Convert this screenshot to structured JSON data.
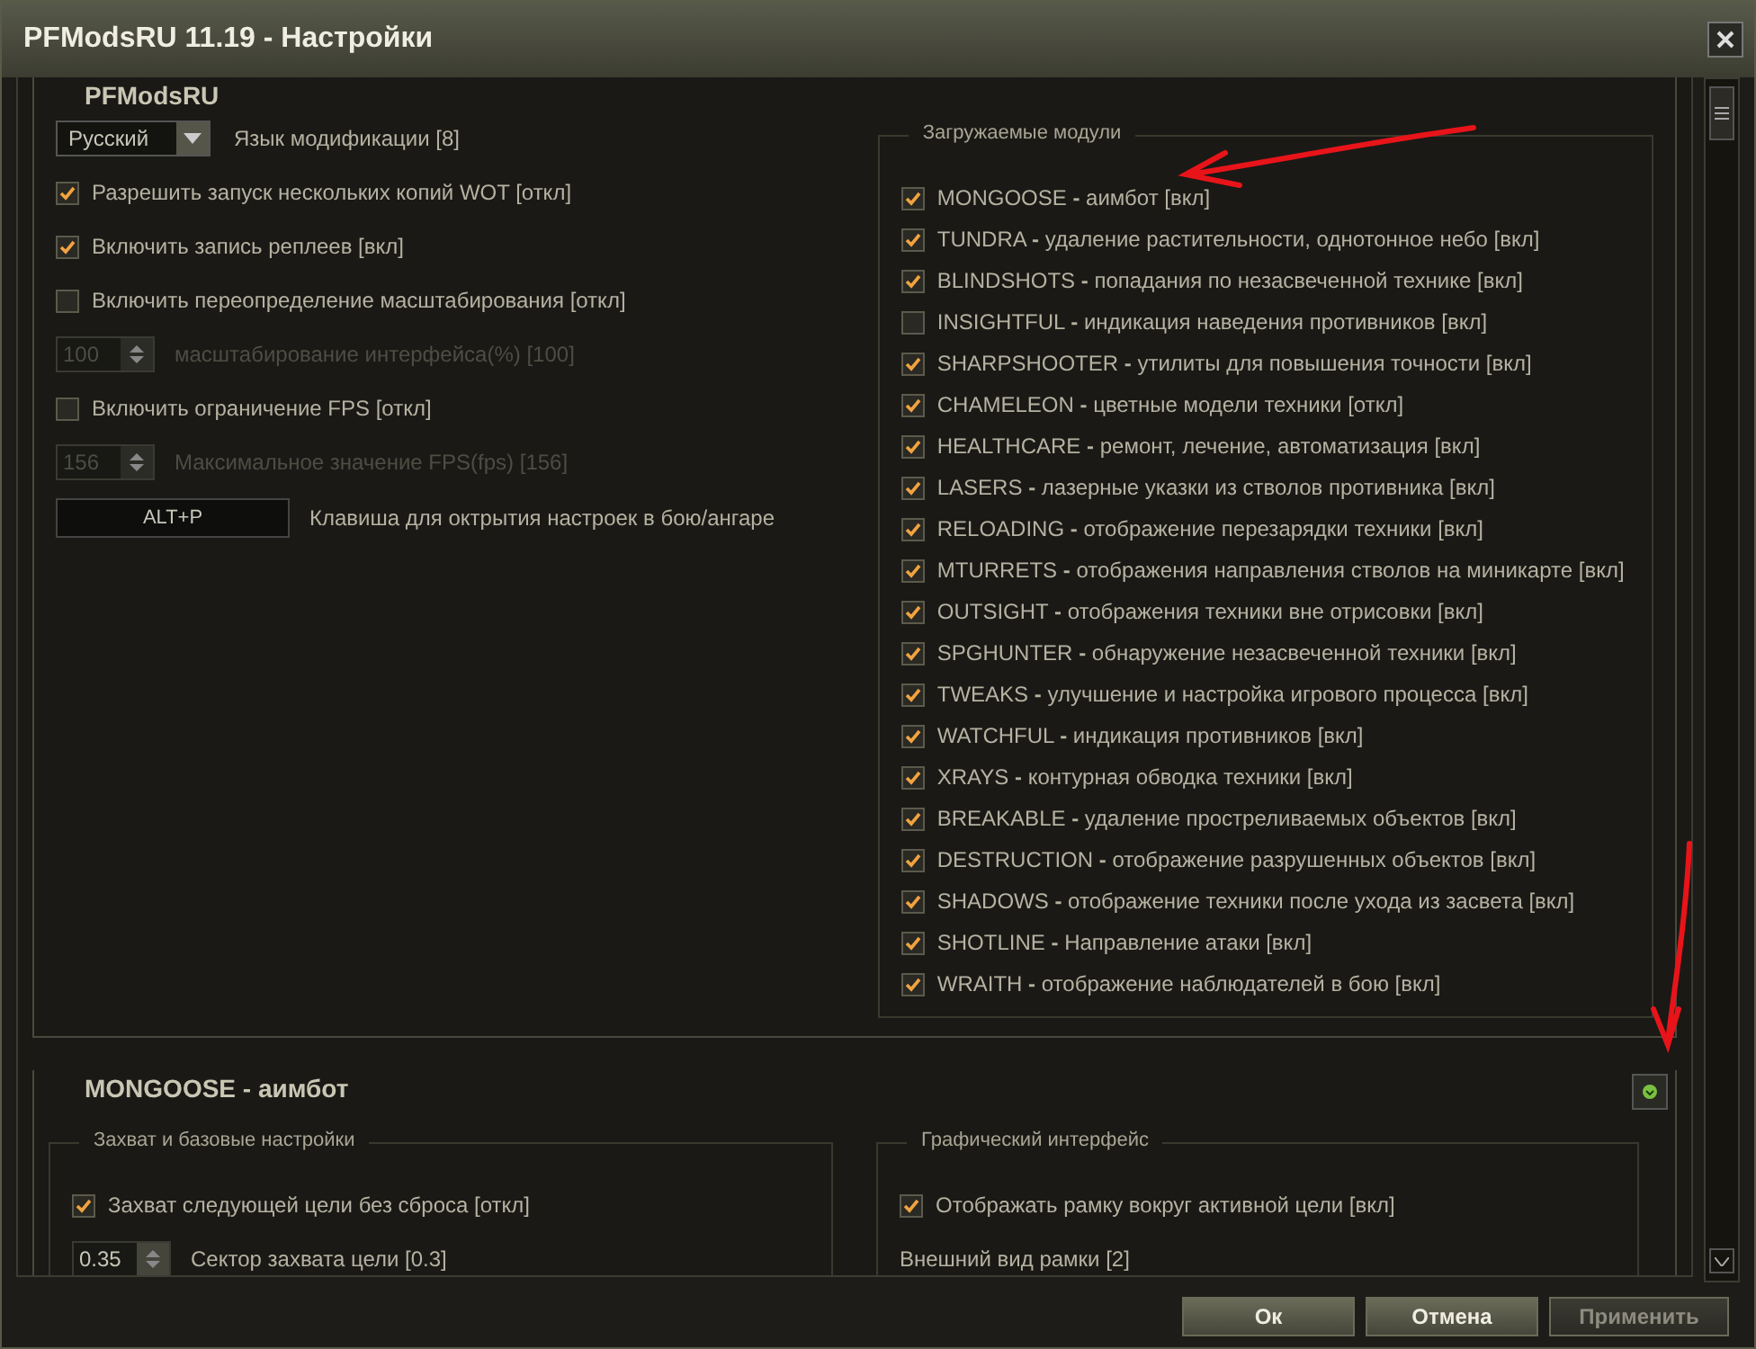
{
  "window": {
    "title": "PFModsRU 11.19 - Настройки"
  },
  "general": {
    "title": "PFModsRU",
    "options": [
      {
        "kind": "select",
        "current": "Русский",
        "caption": "Язык модификации [8]"
      },
      {
        "kind": "checkbox",
        "checked": true,
        "label": "Разрешить запуск нескольких копий WOT [откл]"
      },
      {
        "kind": "checkbox",
        "checked": true,
        "label": "Включить запись реплеев [вкл]"
      },
      {
        "kind": "checkbox",
        "checked": false,
        "label": "Включить переопределение масштабирования [откл]"
      },
      {
        "kind": "spinner",
        "disabled": true,
        "number": "100",
        "caption": "масштабирование интерфейса(%) [100]"
      },
      {
        "kind": "checkbox",
        "checked": false,
        "label": "Включить ограничение FPS [откл]"
      },
      {
        "kind": "spinner",
        "disabled": true,
        "number": "156",
        "caption": "Максимальное значение FPS(fps) [156]"
      },
      {
        "kind": "hotkey",
        "key": "ALT+P",
        "caption": "Клавиша для октрытия настроек в бою/ангаре"
      }
    ]
  },
  "modules": {
    "title": "Загружаемые модули",
    "items": [
      {
        "checked": true,
        "text": "MONGOOSE **-** аимбот [вкл]"
      },
      {
        "checked": true,
        "text": "TUNDRA **-** удаление растительности, однотонное небо [вкл]"
      },
      {
        "checked": true,
        "text": "BLINDSHOTS **-** попадания по незасвеченной технике [вкл]"
      },
      {
        "checked": false,
        "text": "INSIGHTFUL **-** индикация наведения противников [вкл]"
      },
      {
        "checked": true,
        "text": "SHARPSHOOTER **-** утилиты для повышения точности [вкл]"
      },
      {
        "checked": true,
        "text": "CHAMELEON **-** цветные модели техники [откл]"
      },
      {
        "checked": true,
        "text": "HEALTHCARE **-** ремонт, лечение, автоматизация [вкл]"
      },
      {
        "checked": true,
        "text": "LASERS **-** лазерные указки из стволов противника [вкл]"
      },
      {
        "checked": true,
        "text": "RELOADING **-** отображение перезарядки техники [вкл]"
      },
      {
        "checked": true,
        "text": "MTURRETS **-** отображения направления стволов на миникарте [вкл]"
      },
      {
        "checked": true,
        "text": "OUTSIGHT **-** отображения техники вне отрисовки [вкл]"
      },
      {
        "checked": true,
        "text": "SPGHUNTER **-** обнаружение незасвеченной техники [вкл]"
      },
      {
        "checked": true,
        "text": "TWEAKS **-** улучшение и настройка игрового процесса [вкл]"
      },
      {
        "checked": true,
        "text": "WATCHFUL **-** индикация противников [вкл]"
      },
      {
        "checked": true,
        "text": "XRAYS **-** контурная обводка техники [вкл]"
      },
      {
        "checked": true,
        "text": "BREAKABLE **-** удаление простреливаемых объектов [вкл]"
      },
      {
        "checked": true,
        "text": "DESTRUCTION **-** отображение разрушенных объектов [вкл]"
      },
      {
        "checked": true,
        "text": "SHADOWS **-** отображение техники после ухода из засвета [вкл]"
      },
      {
        "checked": true,
        "text": "SHOTLINE **-** Направление атаки [вкл]"
      },
      {
        "checked": true,
        "text": "WRAITH **-** отображение наблюдателей в бою [вкл]"
      }
    ]
  },
  "mongoose": {
    "title": "MONGOOSE - аимбот",
    "groups": [
      {
        "title": "Захват и базовые настройки",
        "items": [
          {
            "kind": "checkbox",
            "checked": true,
            "label": "Захват следующей цели без сброса [откл]"
          },
          {
            "kind": "spinner",
            "disabled": false,
            "number": "0.35",
            "caption": "Сектор захвата цели [0.3]"
          }
        ]
      },
      {
        "title": "Графический интерфейс",
        "items": [
          {
            "kind": "checkbox",
            "checked": true,
            "label": "Отображать рамку вокруг активной цели [вкл]"
          },
          {
            "kind": "caption",
            "label": "Внешний вид рамки [2]"
          }
        ]
      }
    ]
  },
  "buttons": [
    {
      "label": "Ок",
      "disabled": false
    },
    {
      "label": "Отмена",
      "disabled": false
    },
    {
      "label": "Применить",
      "disabled": true
    }
  ]
}
